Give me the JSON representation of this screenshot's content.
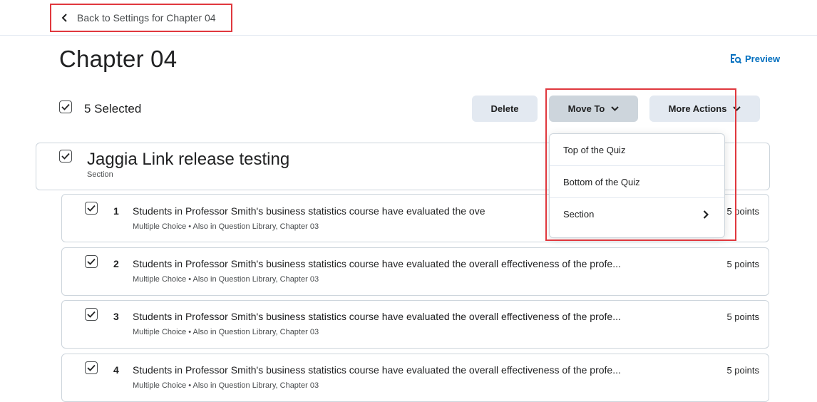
{
  "nav": {
    "back_label": "Back to Settings for Chapter 04"
  },
  "header": {
    "title": "Chapter 04",
    "preview_label": "Preview"
  },
  "toolbar": {
    "selected_label": "5 Selected",
    "delete_label": "Delete",
    "move_to_label": "Move To",
    "more_actions_label": "More Actions"
  },
  "move_menu": {
    "items": [
      {
        "label": "Top of the Quiz"
      },
      {
        "label": "Bottom of the Quiz"
      },
      {
        "label": "Section"
      }
    ]
  },
  "section": {
    "title": "Jaggia Link release testing",
    "type_label": "Section"
  },
  "questions": [
    {
      "number": "1",
      "text": "Students in Professor Smith's business statistics course have evaluated the ove",
      "meta": "Multiple Choice  •  Also in Question Library, Chapter 03",
      "points": "5 points"
    },
    {
      "number": "2",
      "text": "Students in Professor Smith's business statistics course have evaluated the overall effectiveness of the profe...",
      "meta": "Multiple Choice  •  Also in Question Library, Chapter 03",
      "points": "5 points"
    },
    {
      "number": "3",
      "text": "Students in Professor Smith's business statistics course have evaluated the overall effectiveness of the profe...",
      "meta": "Multiple Choice  •  Also in Question Library, Chapter 03",
      "points": "5 points"
    },
    {
      "number": "4",
      "text": "Students in Professor Smith's business statistics course have evaluated the overall effectiveness of the profe...",
      "meta": "Multiple Choice  •  Also in Question Library, Chapter 03",
      "points": "5 points"
    }
  ],
  "colors": {
    "accent_link": "#006fbf",
    "highlight": "#e0383e",
    "button_bg": "#e3e9f1",
    "button_active_bg": "#cdd5dc"
  }
}
